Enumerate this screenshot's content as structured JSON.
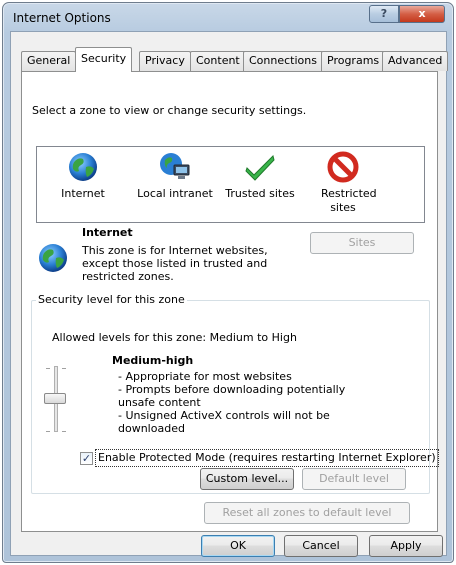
{
  "window": {
    "title": "Internet Options",
    "help_glyph": "?",
    "close_glyph": "x"
  },
  "tabs": [
    {
      "label": "General"
    },
    {
      "label": "Security"
    },
    {
      "label": "Privacy"
    },
    {
      "label": "Content"
    },
    {
      "label": "Connections"
    },
    {
      "label": "Programs"
    },
    {
      "label": "Advanced"
    }
  ],
  "active_tab": "Security",
  "zones": {
    "instruction": "Select a zone to view or change security settings.",
    "items": [
      {
        "label": "Internet",
        "icon": "globe-icon"
      },
      {
        "label": "Local intranet",
        "icon": "intranet-icon"
      },
      {
        "label": "Trusted sites",
        "icon": "checkmark-icon"
      },
      {
        "label": "Restricted sites",
        "icon": "prohibited-icon"
      }
    ]
  },
  "zone_info": {
    "name": "Internet",
    "description": "This zone is for Internet websites, except those listed in trusted and restricted zones.",
    "sites_button": "Sites"
  },
  "security_level": {
    "group_title": "Security level for this zone",
    "allowed": "Allowed levels for this zone: Medium to High",
    "level_name": "Medium-high",
    "details": [
      "- Appropriate for most websites",
      "- Prompts before downloading potentially unsafe content",
      "- Unsigned ActiveX controls will not be downloaded"
    ],
    "protected_mode_checked": true,
    "protected_mode_label": "Enable Protected Mode (requires restarting Internet Explorer)",
    "custom_level_button": "Custom level...",
    "default_level_button": "Default level"
  },
  "reset_button": "Reset all zones to default level",
  "footer": {
    "ok": "OK",
    "cancel": "Cancel",
    "apply": "Apply"
  },
  "colors": {
    "accent": "#3c7fb1",
    "disabled_text": "#a0a0a0",
    "titlebar": "#b7cbe0",
    "close": "#c4391d"
  }
}
